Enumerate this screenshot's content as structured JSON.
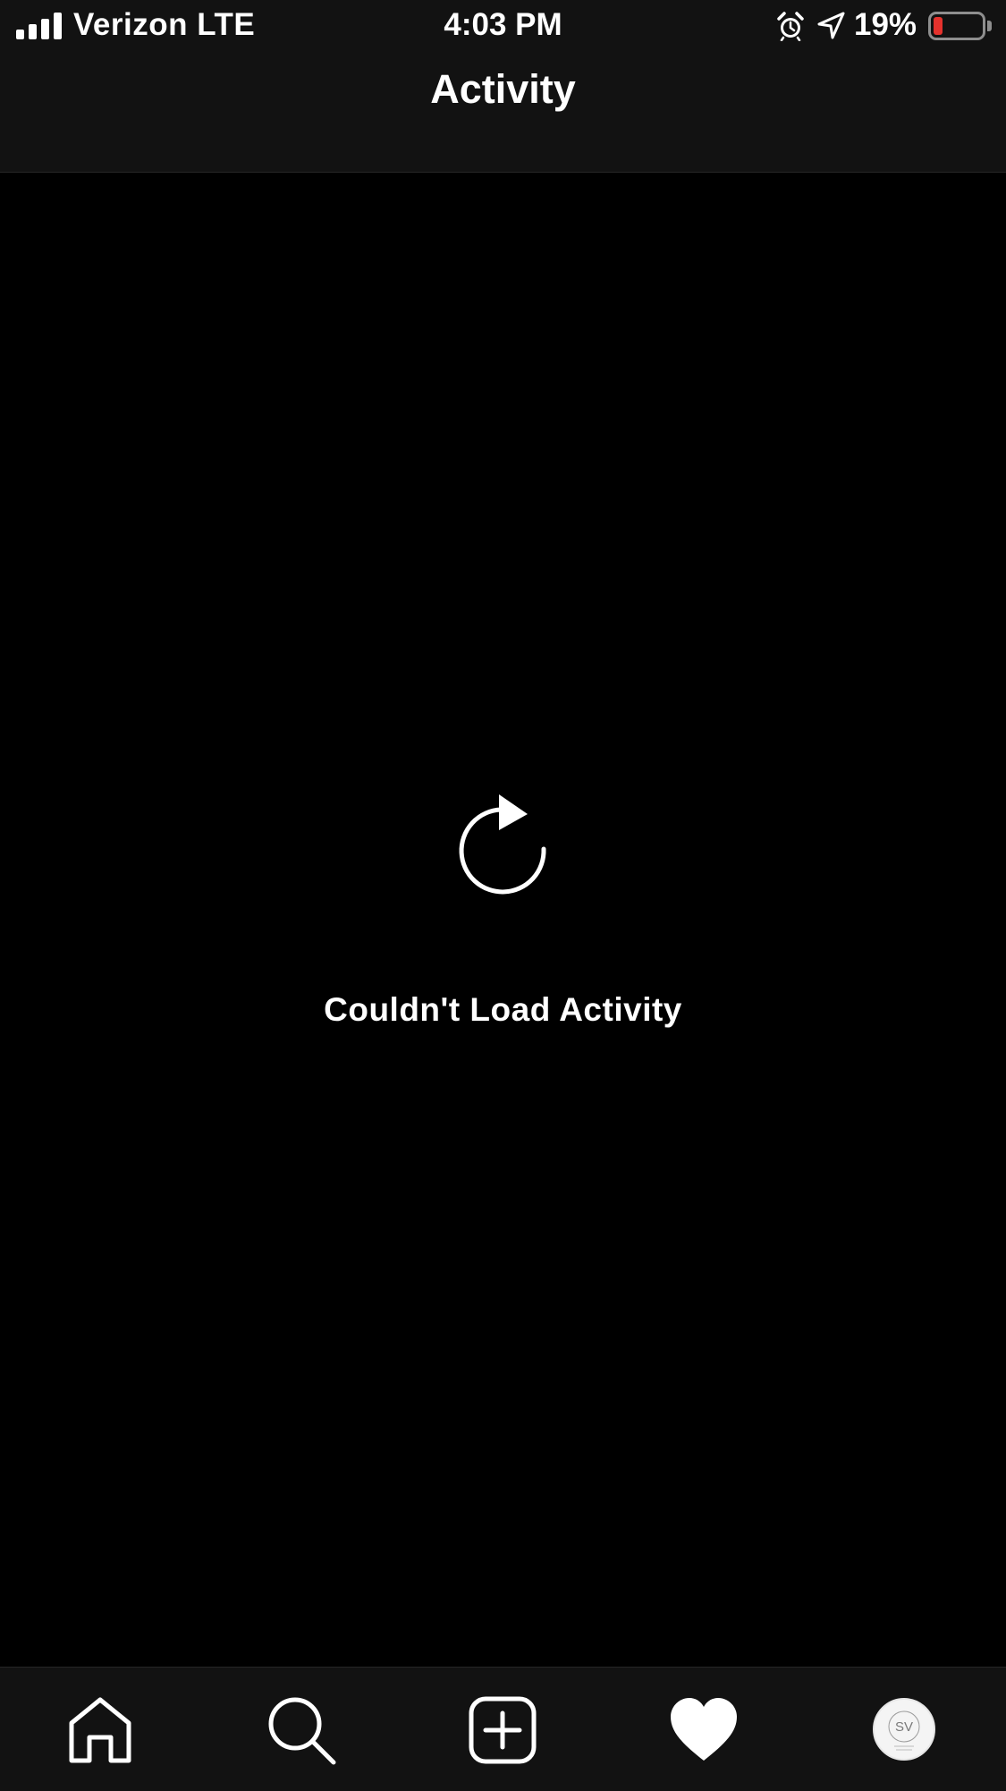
{
  "status_bar": {
    "carrier": "Verizon LTE",
    "time": "4:03 PM",
    "battery_percent": "19%",
    "battery_level": 0.19,
    "battery_color": "#e5322d",
    "signal_bars": 4,
    "icons": [
      "signal-icon",
      "alarm-icon",
      "location-arrow-icon",
      "battery-icon"
    ]
  },
  "header": {
    "title": "Activity"
  },
  "main": {
    "error_message": "Couldn't Load Activity",
    "reload_icon": "reload-icon"
  },
  "tab_bar": {
    "tabs": [
      {
        "id": "home",
        "icon": "home-icon"
      },
      {
        "id": "search",
        "icon": "search-icon"
      },
      {
        "id": "new-post",
        "icon": "add-post-icon"
      },
      {
        "id": "activity",
        "icon": "heart-icon",
        "selected": true
      },
      {
        "id": "profile",
        "icon": "avatar"
      }
    ]
  },
  "colors": {
    "background": "#000000",
    "bar_background": "#121212",
    "foreground": "#ffffff"
  }
}
